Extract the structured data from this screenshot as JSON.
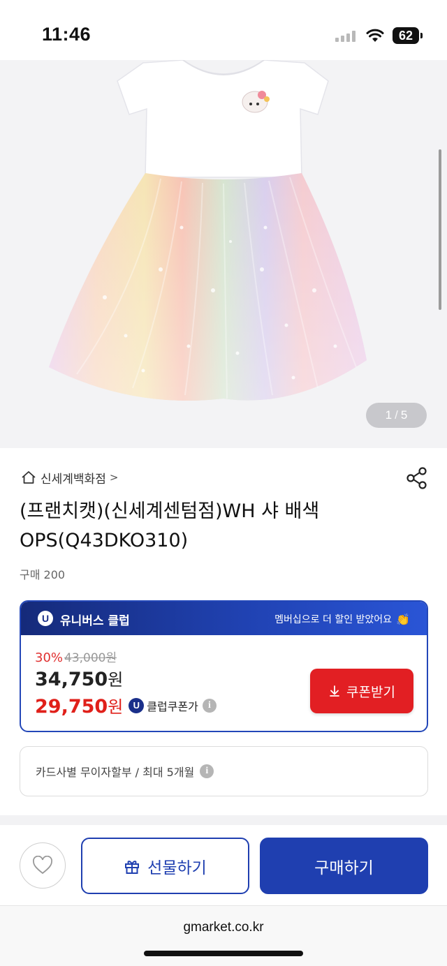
{
  "status_bar": {
    "time": "11:46",
    "battery": "62"
  },
  "gallery": {
    "current": "1",
    "separator": "/",
    "total": "5"
  },
  "product": {
    "store_name": "신세계백화점",
    "store_chevron": ">",
    "title_line1": "(프랜치캣)(신세계센텀점)WH 샤 배색",
    "title_line2": "OPS(Q43DKO310)",
    "purchase_count": "구매 200"
  },
  "club": {
    "badge": "U",
    "title": "유니버스 클럽",
    "note": "멤버십으로 더 할인 받았어요",
    "discount_rate": "30%",
    "original_price": "43,000원",
    "sale_price": "34,750",
    "sale_price_unit": "원",
    "club_price": "29,750",
    "club_price_unit": "원",
    "club_coupon_label": "클럽쿠폰가",
    "coupon_button": "쿠폰받기"
  },
  "installment": {
    "text": "카드사별 무이자할부 / 최대 5개월"
  },
  "bottom_bar": {
    "gift_label": "선물하기",
    "buy_label": "구매하기"
  },
  "browser": {
    "url": "gmarket.co.kr"
  },
  "colors": {
    "brand_blue": "#1f3fb0",
    "sale_red": "#e0201a",
    "coupon_red": "#e21f23"
  }
}
